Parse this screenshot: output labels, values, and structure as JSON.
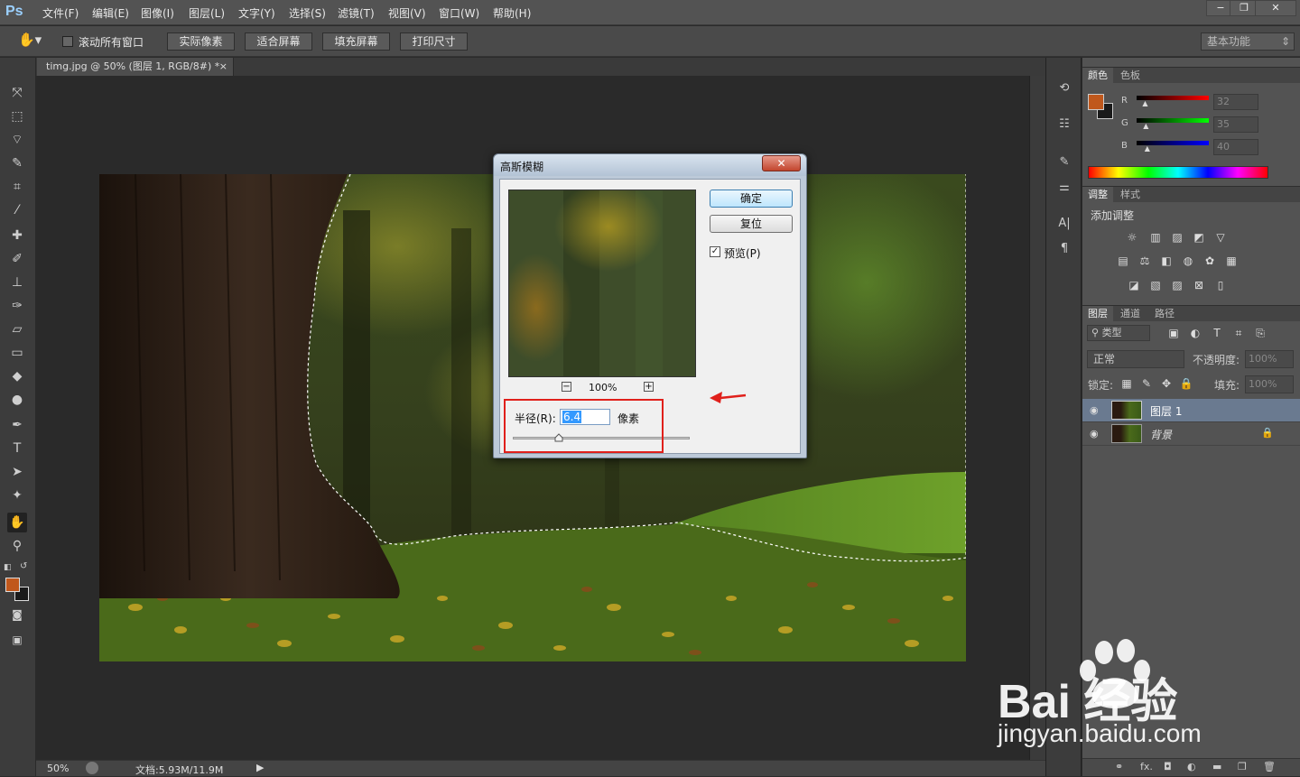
{
  "app": {
    "logo": "Ps",
    "menu": [
      "文件(F)",
      "编辑(E)",
      "图像(I)",
      "图层(L)",
      "文字(Y)",
      "选择(S)",
      "滤镜(T)",
      "视图(V)",
      "窗口(W)",
      "帮助(H)"
    ],
    "window_controls": [
      "−",
      "❐",
      "✕"
    ]
  },
  "options_bar": {
    "tool_icon": "hand-icon",
    "scroll_all_windows_label": "滚动所有窗口",
    "actual_pixels": "实际像素",
    "fit_screen": "适合屏幕",
    "fill_screen": "填充屏幕",
    "print_size": "打印尺寸",
    "workspace": "基本功能"
  },
  "document": {
    "tab_title": "timg.jpg @ 50% (图层 1, RGB/8#) *",
    "tab_close": "×",
    "zoom": "50%",
    "doc_size": "文档:5.93M/11.9M"
  },
  "dialog": {
    "title": "高斯模糊",
    "close": "✕",
    "ok": "确定",
    "reset": "复位",
    "preview_label": "预览(P)",
    "preview_checked": true,
    "zoom_out": "−",
    "zoom_in": "+",
    "preview_zoom": "100%",
    "radius_label": "半径(R):",
    "radius_value": "6.4",
    "radius_unit": "像素",
    "radius_slider": 0.26
  },
  "color_panel": {
    "tabs": [
      "颜色",
      "色板"
    ],
    "channels": [
      {
        "label": "R",
        "value": "32",
        "slider": 0.13
      },
      {
        "label": "G",
        "value": "35",
        "slider": 0.14
      },
      {
        "label": "B",
        "value": "40",
        "slider": 0.16
      }
    ],
    "foreground": "#c0581c",
    "background": "#1a1a1a"
  },
  "adjustments_panel": {
    "tabs": [
      "调整",
      "样式"
    ],
    "heading": "添加调整"
  },
  "layers_panel": {
    "tabs": [
      "图层",
      "通道",
      "路径"
    ],
    "filter_kind": "类型",
    "blend_mode": "正常",
    "opacity_label": "不透明度:",
    "opacity_value": "100%",
    "lock_label": "锁定:",
    "fill_label": "填充:",
    "fill_value": "100%",
    "layers": [
      {
        "name": "图层 1",
        "selected": true,
        "locked": false
      },
      {
        "name": "背景",
        "selected": false,
        "locked": true
      }
    ],
    "footer_icons": [
      "link-icon",
      "fx-icon",
      "mask-icon",
      "adjustment-icon",
      "group-icon",
      "new-layer-icon",
      "trash-icon"
    ],
    "fx_text": "fx."
  },
  "watermark": {
    "brand": "Bai 经验",
    "url": "jingyan.baidu.com"
  }
}
